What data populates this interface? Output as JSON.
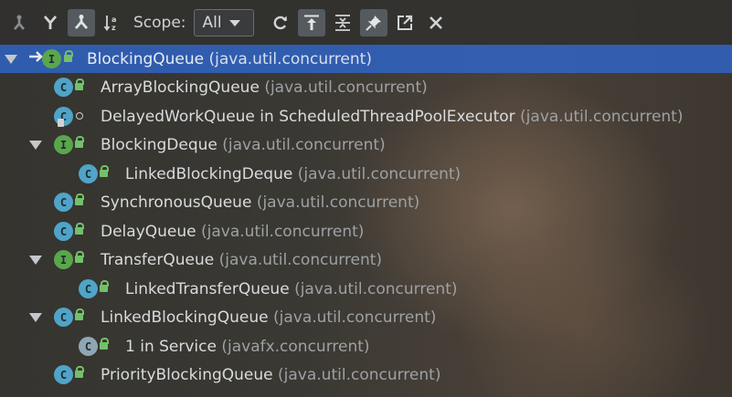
{
  "toolbar": {
    "scope_label": "Scope:",
    "scope_value": "All",
    "buttons": [
      {
        "icon": "supertypes-hierarchy-icon"
      },
      {
        "icon": "subtypes-hierarchy-icon"
      },
      {
        "icon": "type-hierarchy-icon",
        "active": true
      },
      {
        "icon": "sort-alphabetically-icon"
      }
    ],
    "actions": [
      {
        "icon": "refresh-icon"
      },
      {
        "icon": "expand-all-icon",
        "active": true
      },
      {
        "icon": "collapse-all-icon"
      },
      {
        "icon": "pin-icon",
        "active": true
      },
      {
        "icon": "open-in-new-tab-icon"
      },
      {
        "icon": "close-icon"
      }
    ]
  },
  "tree": [
    {
      "name": "BlockingQueue",
      "pkg": "(java.util.concurrent)",
      "kind": "interface",
      "expanded": true,
      "selected": true
    },
    {
      "name": "ArrayBlockingQueue",
      "pkg": "(java.util.concurrent)",
      "kind": "class"
    },
    {
      "name": "DelayedWorkQueue in ScheduledThreadPoolExecutor",
      "pkg": "(java.util.concurrent)",
      "kind": "class"
    },
    {
      "name": "BlockingDeque",
      "pkg": "(java.util.concurrent)",
      "kind": "interface",
      "expanded": true
    },
    {
      "name": "LinkedBlockingDeque",
      "pkg": "(java.util.concurrent)",
      "kind": "class"
    },
    {
      "name": "SynchronousQueue",
      "pkg": "(java.util.concurrent)",
      "kind": "class"
    },
    {
      "name": "DelayQueue",
      "pkg": "(java.util.concurrent)",
      "kind": "class"
    },
    {
      "name": "TransferQueue",
      "pkg": "(java.util.concurrent)",
      "kind": "interface",
      "expanded": true
    },
    {
      "name": "LinkedTransferQueue",
      "pkg": "(java.util.concurrent)",
      "kind": "class"
    },
    {
      "name": "LinkedBlockingQueue",
      "pkg": "(java.util.concurrent)",
      "kind": "class",
      "expanded": true
    },
    {
      "name": "1 in Service",
      "pkg": "(javafx.concurrent)",
      "kind": "anonymous"
    },
    {
      "name": "PriorityBlockingQueue",
      "pkg": "(java.util.concurrent)",
      "kind": "class"
    }
  ],
  "colors": {
    "selection": "#2f65ca",
    "class_badge": "#4fa4c8",
    "interface_badge": "#5aa64c",
    "access_lock": "#73c06a"
  }
}
